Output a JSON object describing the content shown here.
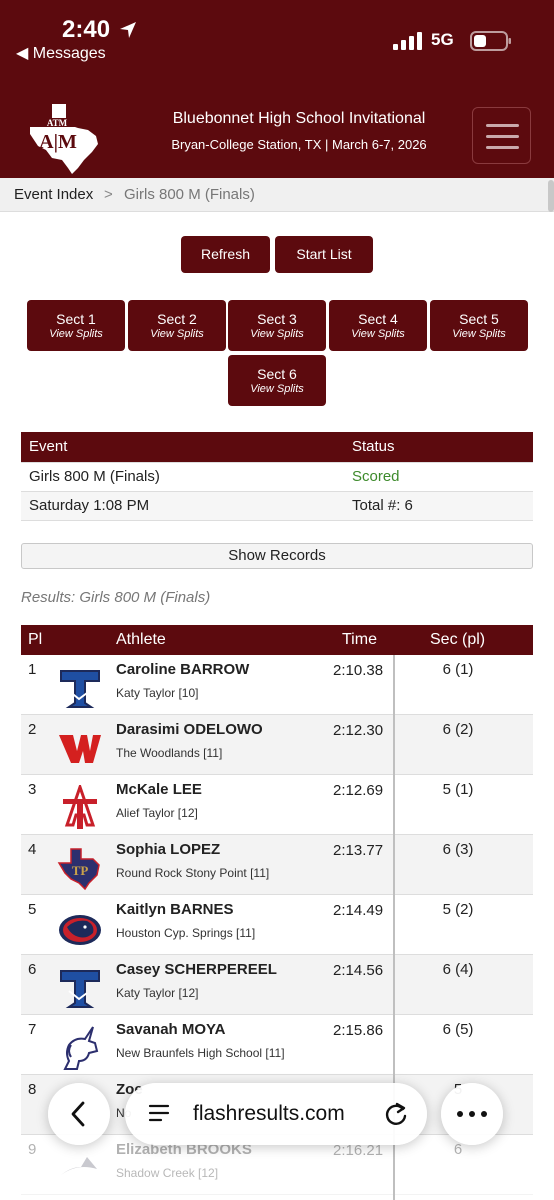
{
  "status_bar": {
    "time": "2:40",
    "back_label": "◀ Messages",
    "network": "5G"
  },
  "header": {
    "logo_text": "ATM",
    "title": "Bluebonnet High School Invitational",
    "subtitle": "Bryan-College Station, TX | March 6-7, 2026"
  },
  "breadcrumb": {
    "index": "Event Index",
    "separator": ">",
    "current": "Girls 800 M (Finals)"
  },
  "buttons": {
    "refresh": "Refresh",
    "start_list": "Start List"
  },
  "sections": [
    {
      "label": "Sect 1",
      "sub": "View Splits"
    },
    {
      "label": "Sect 2",
      "sub": "View Splits"
    },
    {
      "label": "Sect 3",
      "sub": "View Splits"
    },
    {
      "label": "Sect 4",
      "sub": "View Splits"
    },
    {
      "label": "Sect 5",
      "sub": "View Splits"
    },
    {
      "label": "Sect 6",
      "sub": "View Splits"
    }
  ],
  "event_table": {
    "headers": [
      "Event",
      "Status"
    ],
    "rows": [
      [
        "Girls 800 M (Finals)",
        "Scored"
      ],
      [
        "Saturday 1:08 PM",
        "Total #: 6"
      ]
    ]
  },
  "records_button": "Show Records",
  "results_caption": "Results: Girls 800 M (Finals)",
  "results": {
    "headers": {
      "place": "Pl",
      "athlete": "Athlete",
      "time": "Time",
      "section": "Sec (pl)"
    },
    "rows": [
      {
        "place": "1",
        "name": "Caroline BARROW",
        "school": "Katy Taylor [10]",
        "time": "2:10.38",
        "section": "6 (1)",
        "logo": "katy-taylor-t-icon"
      },
      {
        "place": "2",
        "name": "Darasimi ODELOWO",
        "school": "The Woodlands [11]",
        "time": "2:12.30",
        "section": "6 (2)",
        "logo": "woodlands-w-icon"
      },
      {
        "place": "3",
        "name": "McKale LEE",
        "school": "Alief Taylor [12]",
        "time": "2:12.69",
        "section": "5 (1)",
        "logo": "alief-taylor-at-icon"
      },
      {
        "place": "4",
        "name": "Sophia LOPEZ",
        "school": "Round Rock Stony Point [11]",
        "time": "2:13.77",
        "section": "6 (3)",
        "logo": "stony-point-texas-icon"
      },
      {
        "place": "5",
        "name": "Kaitlyn BARNES",
        "school": "Houston Cyp. Springs [11]",
        "time": "2:14.49",
        "section": "5 (2)",
        "logo": "cypress-springs-panther-icon"
      },
      {
        "place": "6",
        "name": "Casey SCHERPEREEL",
        "school": "Katy Taylor [12]",
        "time": "2:14.56",
        "section": "6 (4)",
        "logo": "katy-taylor-t-icon"
      },
      {
        "place": "7",
        "name": "Savanah MOYA",
        "school": "New Braunfels High School [11]",
        "time": "2:15.86",
        "section": "6 (5)",
        "logo": "unicorn-icon"
      },
      {
        "place": "8",
        "name": "Zoe",
        "school": "No",
        "time": "",
        "section": "5",
        "logo": ""
      },
      {
        "place": "9",
        "name": "Elizabeth BROOKS",
        "school": "Shadow Creek [12]",
        "time": "2:16.21",
        "section": "6",
        "logo": "shark-icon"
      }
    ]
  },
  "browser": {
    "url": "flashresults.com"
  },
  "colors": {
    "maroon": "#5c0a0e",
    "scored_green": "#3d8a2b",
    "taylor_blue": "#1f4fa3",
    "woodlands_red": "#d4201f",
    "alief_red": "#c8202a",
    "navy": "#1d2a5a"
  }
}
